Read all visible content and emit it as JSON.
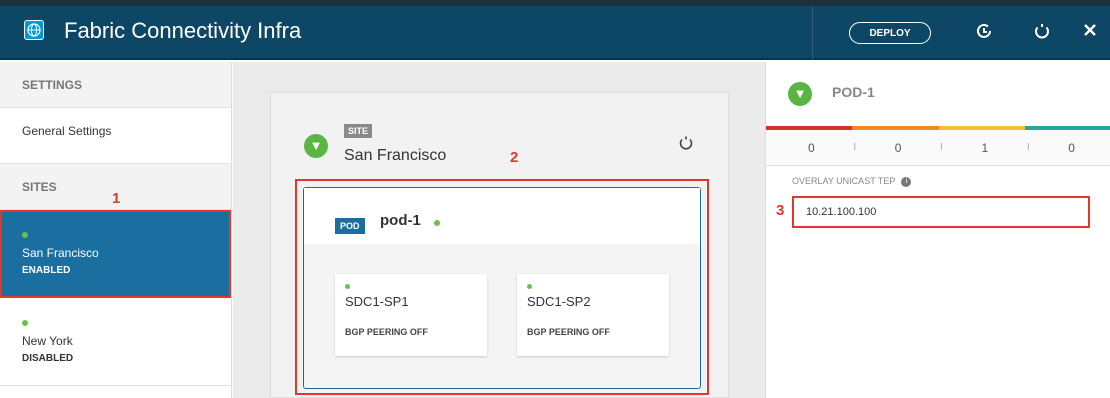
{
  "header": {
    "title": "Fabric Connectivity Infra",
    "deploy_label": "DEPLOY",
    "icons": [
      "globe-icon",
      "sync-icon",
      "refresh-icon",
      "close-icon"
    ]
  },
  "sidebar": {
    "settings_heading": "SETTINGS",
    "general_settings": "General Settings",
    "sites_heading": "SITES",
    "sites": [
      {
        "name": "San Francisco",
        "status": "ENABLED",
        "active": true
      },
      {
        "name": "New York",
        "status": "DISABLED",
        "active": false
      }
    ]
  },
  "site": {
    "badge": "SITE",
    "name": "San Francisco",
    "pod": {
      "badge": "POD",
      "name": "pod-1",
      "spines": [
        {
          "name": "SDC1-SP1",
          "status": "BGP PEERING OFF"
        },
        {
          "name": "SDC1-SP2",
          "status": "BGP PEERING OFF"
        }
      ]
    }
  },
  "panel": {
    "title": "POD-1",
    "counts": [
      "0",
      "0",
      "1",
      "0"
    ],
    "count_separator": "I",
    "tep_label": "OVERLAY UNICAST TEP",
    "tep_value": "10.21.100.100"
  },
  "annotations": [
    "1",
    "2",
    "3"
  ],
  "colors": {
    "header": "#0e4766",
    "active_site": "#1a6fa0",
    "ok": "#5ab545",
    "highlight": "#e0392b",
    "health_bar": [
      "#d7302c",
      "#f08a24",
      "#f6c12d",
      "#2aa59a"
    ]
  }
}
